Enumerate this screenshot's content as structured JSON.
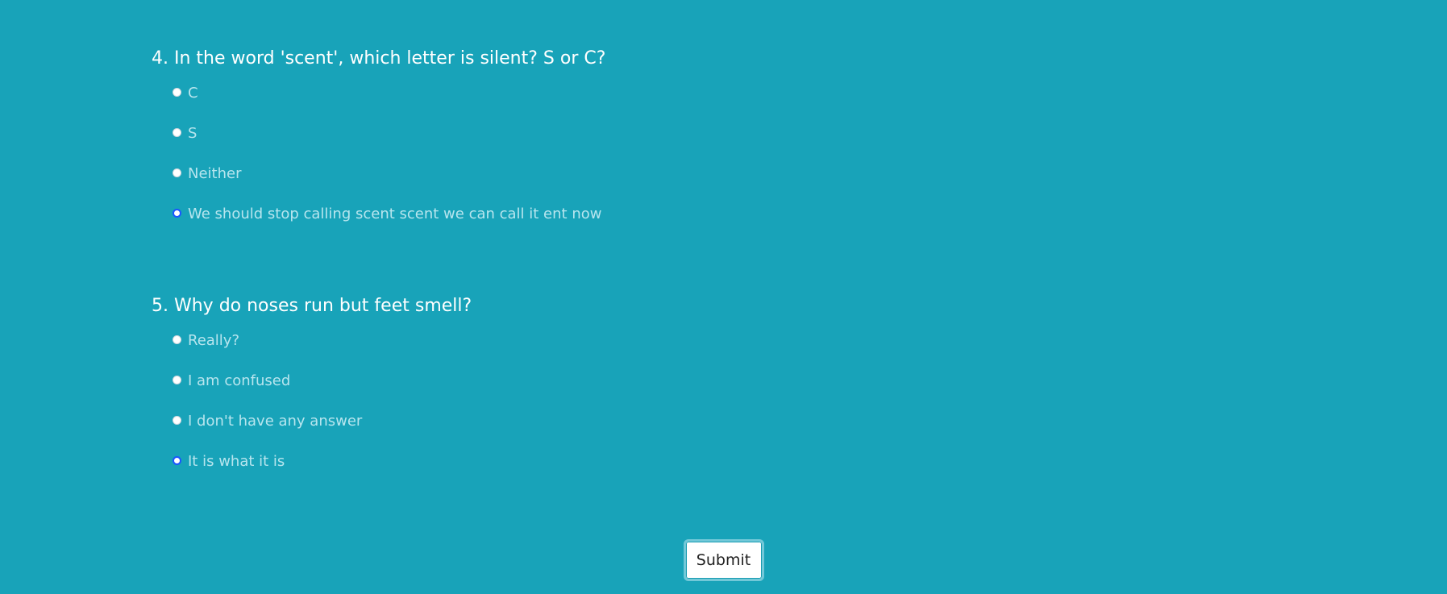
{
  "questions": [
    {
      "title": "4. In the word 'scent', which letter is silent? S or C?",
      "selected_index": 3,
      "options": [
        "C",
        "S",
        "Neither",
        "We should stop calling scent scent we can call it ent now"
      ]
    },
    {
      "title": "5. Why do noses run but feet smell?",
      "selected_index": 3,
      "options": [
        "Really?",
        "I am confused",
        "I don't have any answer",
        "It is what it is"
      ]
    }
  ],
  "submit": {
    "label": "Submit"
  },
  "colors": {
    "background": "#18a3b9",
    "question_text": "#ffffff",
    "option_text": "#b7e5ee",
    "selected_radio": "#1a55ff"
  }
}
